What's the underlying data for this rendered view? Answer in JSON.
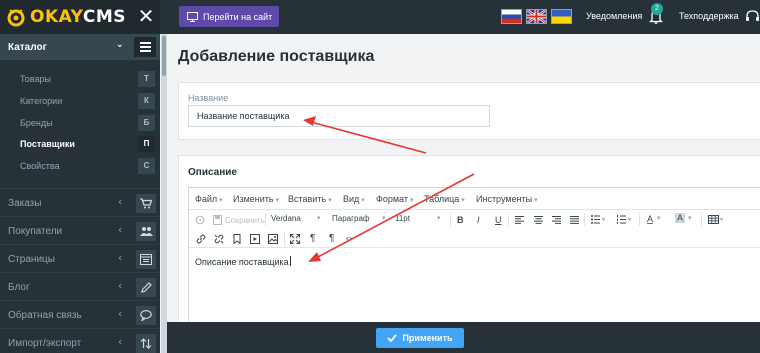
{
  "logo": {
    "brand_ok": "OKAY",
    "brand_rest": "CMS"
  },
  "sidebar": {
    "close_icon": "close-icon",
    "catalog": {
      "label": "Каталог",
      "chevron": "⌄"
    },
    "sub_items": [
      {
        "label": "Товары",
        "letter": "Т",
        "active": false
      },
      {
        "label": "Категории",
        "letter": "К",
        "active": false
      },
      {
        "label": "Бренды",
        "letter": "Б",
        "active": false
      },
      {
        "label": "Поставщики",
        "letter": "П",
        "active": true
      },
      {
        "label": "Свойства",
        "letter": "С",
        "active": false
      }
    ],
    "nav_items": [
      {
        "label": "Заказы",
        "icon": "cart-icon",
        "chevron": "‹"
      },
      {
        "label": "Покупатели",
        "icon": "users-icon",
        "chevron": "‹"
      },
      {
        "label": "Страницы",
        "icon": "pages-icon",
        "chevron": "‹"
      },
      {
        "label": "Блог",
        "icon": "pencil-icon",
        "chevron": "‹"
      },
      {
        "label": "Обратная связь",
        "icon": "chat-icon",
        "chevron": "‹"
      },
      {
        "label": "Импорт/экспорт",
        "icon": "import-export-icon",
        "chevron": "‹"
      }
    ]
  },
  "topbar": {
    "goto_site": "Перейти на сайт",
    "notifications": "Уведомления",
    "notifications_count": "2",
    "support": "Техподдержка"
  },
  "main": {
    "title": "Добавление поставщика",
    "name_label": "Название",
    "name_value": "Название поставщика",
    "description_title": "Описание",
    "description_value": "Описание поставщика"
  },
  "editor": {
    "menu": [
      "Файл",
      "Изменить",
      "Вставить",
      "Вид",
      "Формат",
      "Таблица",
      "Инструменты"
    ],
    "save": "Сохранить",
    "font_family": "Verdana",
    "block_format": "Параграф",
    "font_size": "11pt",
    "bold": "B",
    "italic": "I",
    "underline": "U",
    "text_color": "A",
    "bg_color": "A",
    "pilcrow1": "¶",
    "pilcrow2": "¶",
    "code": "‹›"
  },
  "footer": {
    "apply": "Применить"
  },
  "colors": {
    "sidebar_bg": "#263238",
    "accent_purple": "#5e4aa9",
    "apply_blue": "#42a5f5",
    "arrow_red": "#e53935",
    "badge_teal": "#26a69a"
  }
}
